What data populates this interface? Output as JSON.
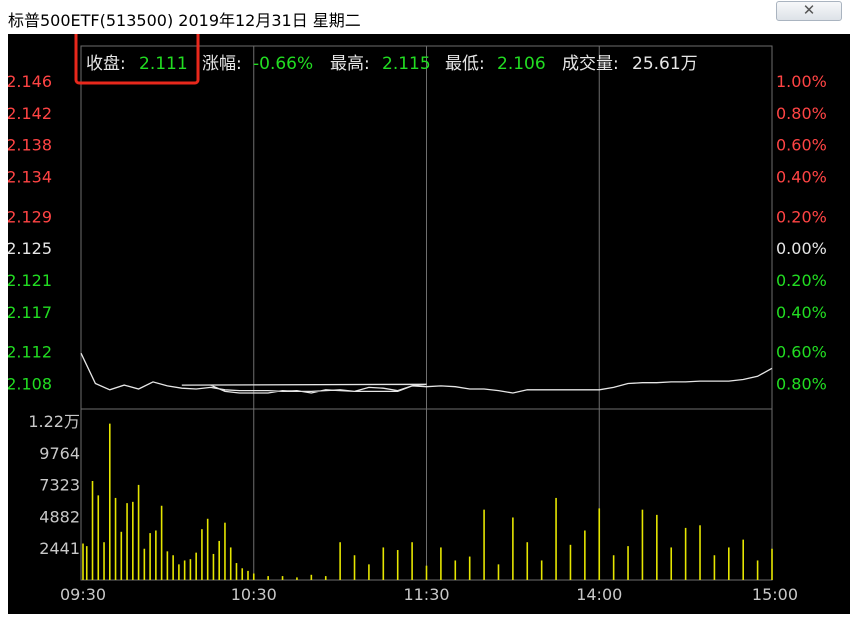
{
  "window": {
    "title": "标普500ETF(513500)  2019年12月31日  星期二",
    "close_icon": "close-icon"
  },
  "info_bar": {
    "close_label": "收盘:",
    "close_value": "2.111",
    "change_label": "涨幅:",
    "change_value": "-0.66%",
    "high_label": "最高:",
    "high_value": "2.115",
    "low_label": "最低:",
    "low_value": "2.106",
    "volume_label": "成交量:",
    "volume_value": "25.61万",
    "highlight_color": "#e8281c"
  },
  "colors": {
    "up": "#ff4444",
    "down": "#22dd22",
    "flat": "#e6e6e6",
    "price_line": "#e6e6e6",
    "volume_bar": "#e6e600",
    "grid": "#6e6e6e",
    "axis_text": "#c8c8c8"
  },
  "chart_data": {
    "type": "line",
    "title": "",
    "price": {
      "y_ticks": [
        "2.146",
        "2.142",
        "2.138",
        "2.134",
        "2.129",
        "2.125",
        "2.121",
        "2.117",
        "2.112",
        "2.108"
      ],
      "y_tick_status": [
        "up",
        "up",
        "up",
        "up",
        "up",
        "flat",
        "down",
        "down",
        "down",
        "down"
      ],
      "pct_ticks": [
        "1.00%",
        "0.80%",
        "0.60%",
        "0.40%",
        "0.20%",
        "0.00%",
        "0.20%",
        "0.40%",
        "0.60%",
        "0.80%"
      ],
      "ylim": [
        2.1063,
        2.146
      ],
      "prev_close": 2.125,
      "x": [
        "09:30",
        "09:35",
        "09:40",
        "09:45",
        "09:50",
        "09:55",
        "10:00",
        "10:05",
        "10:10",
        "10:15",
        "10:20",
        "10:25",
        "10:30",
        "10:35",
        "10:40",
        "10:45",
        "10:50",
        "10:55",
        "11:00",
        "11:05",
        "11:10",
        "11:15",
        "11:20",
        "11:25",
        "11:30",
        "11:35",
        "11:40",
        "11:45",
        "11:50",
        "11:55",
        "12:00",
        "12:05",
        "12:10",
        "12:15",
        "12:20",
        "12:25",
        "12:30",
        "12:35",
        "12:40",
        "12:45",
        "12:50",
        "12:55",
        "13:00",
        "13:05",
        "13:10",
        "13:15",
        "13:20",
        "13:25",
        "13:30",
        "13:35",
        "13:40",
        "13:45",
        "13:50",
        "13:55",
        "14:00",
        "14:05",
        "14:10",
        "14:15",
        "14:20",
        "14:25",
        "14:30",
        "14:35",
        "14:40",
        "14:45",
        "14:50",
        "14:55",
        "15:00"
      ],
      "values": [
        2.1118,
        2.108,
        2.1072,
        2.1078,
        2.1073,
        2.1082,
        2.1077,
        2.1074,
        2.1073,
        2.1075,
        2.1072,
        2.1071,
        2.1071,
        2.1071,
        2.107,
        2.1071,
        2.1068,
        2.1072,
        2.1071,
        2.107,
        2.1075,
        2.1074,
        2.1071,
        2.1077,
        2.1079,
        2.1078,
        2.1078,
        2.1078,
        2.107,
        2.1068,
        2.1068,
        2.1068,
        2.1071,
        2.107,
        2.107,
        2.1071,
        2.1072,
        2.107,
        2.107,
        2.107,
        2.107,
        2.1077,
        2.1076,
        2.1077,
        2.1076,
        2.1073,
        2.1073,
        2.1071,
        2.1068,
        2.1072,
        2.1072,
        2.1072,
        2.1072,
        2.1072,
        2.1072,
        2.1075,
        2.108,
        2.1081,
        2.1081,
        2.1082,
        2.1082,
        2.1083,
        2.1083,
        2.1083,
        2.1085,
        2.1089,
        2.1099
      ]
    },
    "volume": {
      "y_ticks": [
        "1.22万",
        "9764",
        "7323",
        "4882",
        "2441"
      ],
      "ylim": [
        0,
        12205
      ],
      "x": [
        "09:30",
        "09:32",
        "09:34",
        "09:36",
        "09:38",
        "09:40",
        "09:42",
        "09:44",
        "09:46",
        "09:48",
        "09:50",
        "09:52",
        "09:54",
        "09:56",
        "09:58",
        "10:00",
        "10:02",
        "10:04",
        "10:06",
        "10:08",
        "10:10",
        "10:12",
        "10:14",
        "10:16",
        "10:18",
        "10:20",
        "10:22",
        "10:24",
        "10:26",
        "10:28",
        "10:30",
        "10:35",
        "10:40",
        "10:45",
        "10:50",
        "10:55",
        "11:00",
        "11:05",
        "11:10",
        "11:15",
        "11:20",
        "11:25",
        "11:30",
        "13:05",
        "13:10",
        "13:15",
        "13:20",
        "13:25",
        "13:30",
        "13:35",
        "13:40",
        "13:45",
        "13:50",
        "13:55",
        "14:00",
        "14:05",
        "14:10",
        "14:15",
        "14:20",
        "14:25",
        "14:30",
        "14:35",
        "14:40",
        "14:45",
        "14:50",
        "14:55",
        "15:00"
      ],
      "values": [
        2800,
        2600,
        7600,
        6500,
        2900,
        12000,
        6300,
        3700,
        5900,
        6000,
        7300,
        2400,
        3600,
        3800,
        5700,
        2200,
        1900,
        1200,
        1500,
        1600,
        2100,
        3900,
        4700,
        2000,
        3000,
        4400,
        2500,
        1300,
        900,
        700,
        500,
        300,
        300,
        200,
        400,
        300,
        2900,
        1900,
        1200,
        2500,
        2300,
        2900,
        1100,
        2500,
        1500,
        1800,
        5400,
        1200,
        4800,
        2900,
        1500,
        6300,
        2700,
        3800,
        5500,
        1900,
        2600,
        5400,
        5000,
        2500,
        4000,
        4200,
        1900,
        2500,
        3100,
        1500,
        2400
      ]
    },
    "x_ticks": [
      "09:30",
      "10:30",
      "11:30",
      "14:00",
      "15:00"
    ]
  }
}
